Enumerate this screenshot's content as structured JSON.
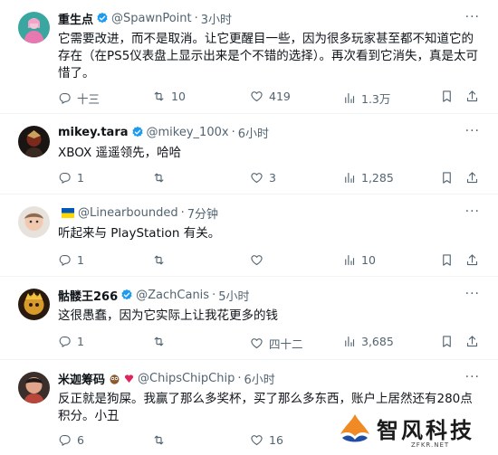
{
  "tweets": [
    {
      "name": "重生点",
      "handle": "@SpawnPoint",
      "time": "3小时",
      "text": "它需要改进，而不是取消。让它更醒目一些，因为很多玩家甚至都不知道它的存在（在PS5仪表盘上显示出来是个不错的选择）。再次看到它消失，真是太可惜了。",
      "replies": "十三",
      "retweets": "10",
      "likes": "419",
      "views": "1.3万"
    },
    {
      "name": "mikey.tara",
      "handle": "@mikey_100x",
      "time": "6小时",
      "text": "XBOX 遥遥领先，哈哈",
      "replies": "1",
      "retweets": "",
      "likes": "3",
      "views": "1,285"
    },
    {
      "name": "",
      "handle": "@Linearbounded",
      "time": "7分钟",
      "text": "听起来与 PlayStation 有关。",
      "replies": "1",
      "retweets": "",
      "likes": "",
      "views": "10"
    },
    {
      "name": "骷髅王266",
      "handle": "@ZachCanis",
      "time": "5小时",
      "text": "这很愚蠢，因为它实际上让我花更多的钱",
      "replies": "1",
      "retweets": "",
      "likes": "四十二",
      "views": "3,685"
    },
    {
      "name": "米迦筹码",
      "handle": "@ChipsChipChip",
      "time": "6小时",
      "text": "反正就是狗屎。我赢了那么多奖杯，买了那么多东西，账户上居然还有280点积分。小丑",
      "replies": "6",
      "retweets": "",
      "likes": "16",
      "views": ""
    }
  ],
  "separator": "·",
  "watermark": {
    "text": "智风科技",
    "url": "ZFKR.NET"
  },
  "colors": {
    "verified": "#1d9bf0",
    "muted": "#536471",
    "ukraine_blue": "#0057b7",
    "ukraine_yellow": "#ffd700",
    "watermark_orange": "#f08a24",
    "watermark_blue": "#1f4ea3"
  },
  "icons": [
    "more-icon",
    "reply-icon",
    "retweet-icon",
    "like-icon",
    "views-icon",
    "bookmark-icon",
    "share-icon",
    "verified-badge-icon",
    "owl-emoji-icon",
    "heart-emoji-icon",
    "ukraine-flag-icon"
  ]
}
